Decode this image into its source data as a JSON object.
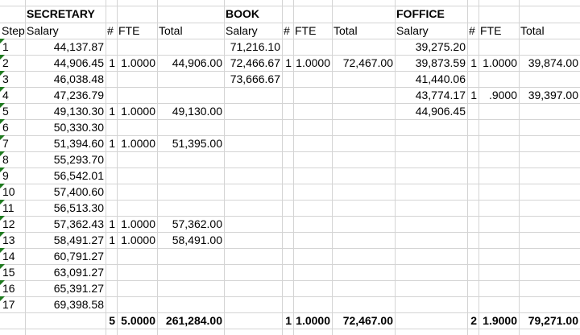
{
  "sheet": {
    "header": {
      "step": "Step",
      "groups": [
        {
          "title": "SECRETARY",
          "salary": "Salary",
          "count": "#",
          "fte": "FTE",
          "total": "Total"
        },
        {
          "title": "BOOK",
          "salary": "Salary",
          "count": "#",
          "fte": "FTE",
          "total": "Total"
        },
        {
          "title": "FOFFICE",
          "salary": "Salary",
          "count": "#",
          "fte": "FTE",
          "total": "Total"
        }
      ]
    },
    "steps": [
      "1",
      "2",
      "3",
      "4",
      "5",
      "6",
      "7",
      "8",
      "9",
      "10",
      "11",
      "12",
      "13",
      "14",
      "15",
      "16",
      "17"
    ],
    "groups": [
      {
        "rows": [
          {
            "salary": "44,137.87",
            "count": "",
            "fte": "",
            "total": ""
          },
          {
            "salary": "44,906.45",
            "count": "1",
            "fte": "1.0000",
            "total": "44,906.00"
          },
          {
            "salary": "46,038.48",
            "count": "",
            "fte": "",
            "total": ""
          },
          {
            "salary": "47,236.79",
            "count": "",
            "fte": "",
            "total": ""
          },
          {
            "salary": "49,130.30",
            "count": "1",
            "fte": "1.0000",
            "total": "49,130.00"
          },
          {
            "salary": "50,330.30",
            "count": "",
            "fte": "",
            "total": ""
          },
          {
            "salary": "51,394.60",
            "count": "1",
            "fte": "1.0000",
            "total": "51,395.00"
          },
          {
            "salary": "55,293.70",
            "count": "",
            "fte": "",
            "total": ""
          },
          {
            "salary": "56,542.01",
            "count": "",
            "fte": "",
            "total": ""
          },
          {
            "salary": "57,400.60",
            "count": "",
            "fte": "",
            "total": ""
          },
          {
            "salary": "56,513.30",
            "count": "",
            "fte": "",
            "total": ""
          },
          {
            "salary": "57,362.43",
            "count": "1",
            "fte": "1.0000",
            "total": "57,362.00"
          },
          {
            "salary": "58,491.27",
            "count": "1",
            "fte": "1.0000",
            "total": "58,491.00"
          },
          {
            "salary": "60,791.27",
            "count": "",
            "fte": "",
            "total": ""
          },
          {
            "salary": "63,091.27",
            "count": "",
            "fte": "",
            "total": ""
          },
          {
            "salary": "65,391.27",
            "count": "",
            "fte": "",
            "total": ""
          },
          {
            "salary": "69,398.58",
            "count": "",
            "fte": "",
            "total": ""
          }
        ],
        "totals": {
          "count": "5",
          "fte": "5.0000",
          "total": "261,284.00"
        }
      },
      {
        "rows": [
          {
            "salary": "71,216.10",
            "count": "",
            "fte": "",
            "total": ""
          },
          {
            "salary": "72,466.67",
            "count": "1",
            "fte": "1.0000",
            "total": "72,467.00"
          },
          {
            "salary": "73,666.67",
            "count": "",
            "fte": "",
            "total": ""
          }
        ],
        "totals": {
          "count": "1",
          "fte": "1.0000",
          "total": "72,467.00"
        }
      },
      {
        "rows": [
          {
            "salary": "39,275.20",
            "count": "",
            "fte": "",
            "total": ""
          },
          {
            "salary": "39,873.59",
            "count": "1",
            "fte": "1.0000",
            "total": "39,874.00"
          },
          {
            "salary": "41,440.06",
            "count": "",
            "fte": "",
            "total": ""
          },
          {
            "salary": "43,774.17",
            "count": "1",
            "fte": ".9000",
            "total": "39,397.00"
          },
          {
            "salary": "44,906.45",
            "count": "",
            "fte": "",
            "total": ""
          }
        ],
        "totals": {
          "count": "2",
          "fte": "1.9000",
          "total": "79,271.00"
        }
      }
    ]
  }
}
